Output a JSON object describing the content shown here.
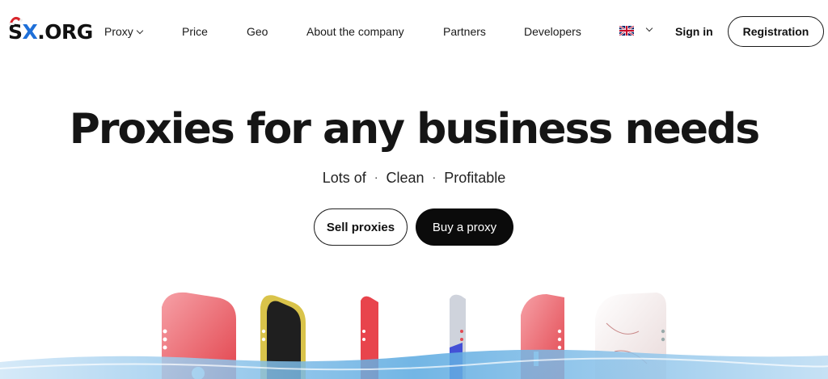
{
  "brand": {
    "logo_text_s": "S",
    "logo_text_x": "X",
    "logo_text_rest": ".ORG"
  },
  "nav": {
    "items": [
      {
        "label": "Proxy",
        "has_dropdown": true
      },
      {
        "label": "Price"
      },
      {
        "label": "Geo"
      },
      {
        "label": "About the company"
      },
      {
        "label": "Partners"
      },
      {
        "label": "Developers"
      }
    ],
    "language": "flag-uk-icon",
    "signin_label": "Sign in",
    "register_label": "Registration"
  },
  "hero": {
    "title": "Proxies for any business needs",
    "tagline": [
      "Lots of",
      "Clean",
      "Profitable"
    ],
    "tagline_separator": "·",
    "sell_label": "Sell proxies",
    "buy_label": "Buy a proxy"
  },
  "colors": {
    "accent_blue": "#1e6fd8",
    "primary_button": "#0b0b0b",
    "text": "#151515"
  }
}
